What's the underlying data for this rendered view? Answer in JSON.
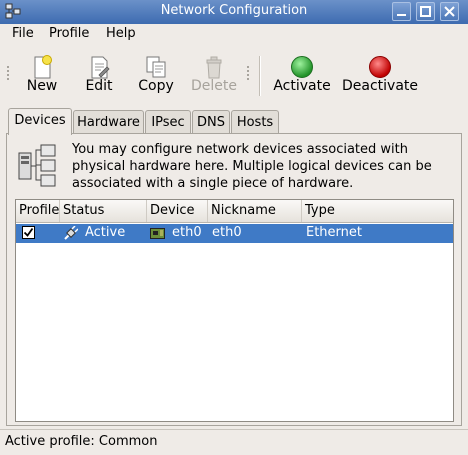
{
  "window": {
    "title": "Network Configuration"
  },
  "menubar": {
    "items": [
      "File",
      "Profile",
      "Help"
    ]
  },
  "toolbar": {
    "new_label": "New",
    "edit_label": "Edit",
    "copy_label": "Copy",
    "delete_label": "Delete",
    "activate_label": "Activate",
    "deactivate_label": "Deactivate"
  },
  "tabs": [
    "Devices",
    "Hardware",
    "IPsec",
    "DNS",
    "Hosts"
  ],
  "info": {
    "text": "You may configure network devices associated with physical hardware here.  Multiple logical devices can be associated with a single piece of hardware."
  },
  "table": {
    "columns": [
      "Profile",
      "Status",
      "Device",
      "Nickname",
      "Type"
    ],
    "rows": [
      {
        "profile_checked": true,
        "status": "Active",
        "device": "eth0",
        "nickname": "eth0",
        "type": "Ethernet"
      }
    ]
  },
  "statusbar": {
    "text": "Active profile: Common"
  },
  "colors": {
    "selection": "#3f7ac6",
    "titlebar": "#4d78b8",
    "activate": "#3aa53a",
    "deactivate": "#d01010"
  }
}
